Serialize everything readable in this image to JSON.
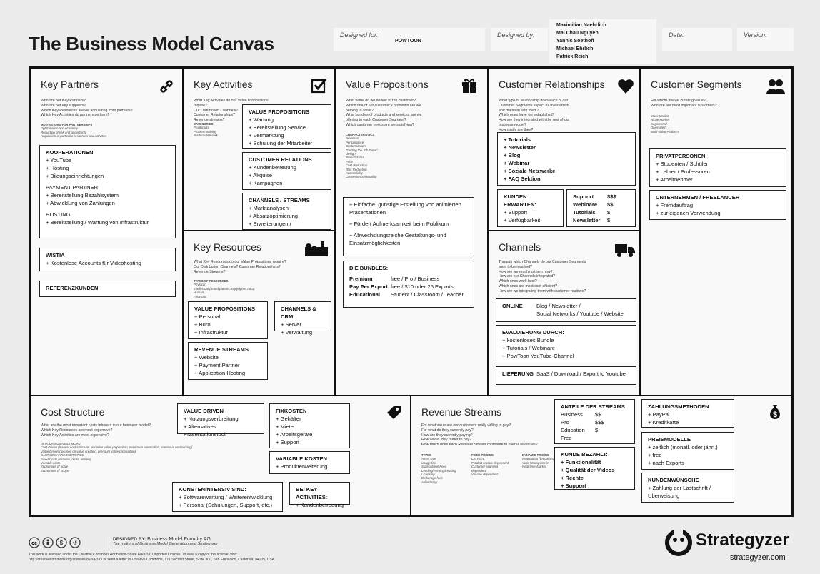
{
  "header": {
    "title": "The Business Model Canvas",
    "designed_for_label": "Designed for:",
    "designed_for_value": "POWTOON",
    "designed_by_label": "Designed by:",
    "designers": [
      "Maximilian Naehrlich",
      "Mai Chau Nguyen",
      "Yannic Soethoff",
      "Michael Ehrlich",
      "Patrick Reich"
    ],
    "date_label": "Date:",
    "version_label": "Version:"
  },
  "kp": {
    "title": "Key Partners",
    "q": [
      "Who are our Key Partners?",
      "Who are our key suppliers?",
      "Which Key Resources are we acquairing from partners?",
      "Which Key Activities do partners perform?"
    ],
    "sub": [
      "MOTIVATIONS FOR PARTNERSHIPS",
      "Optimization and economy",
      "Reduction of risk and uncertainty",
      "Acquisition of particular resources and activities"
    ],
    "n1": [
      "KOOPERATIONEN",
      "+ YouTube",
      "+ Hosting",
      "+ Bildungseinrichtungen",
      "",
      "PAYMENT PARTNER",
      "+ Bereitstellung Bezahlsystem",
      "+ Abwicklung von Zahlungen",
      "",
      "HOSTING",
      "+ Bereitstellung / Wartung von Infrastruktur"
    ],
    "n2": [
      "WISTIA",
      "+ Kostenlose Accounts für Videohosting"
    ],
    "n3": [
      "REFERENZKUNDEN"
    ]
  },
  "ka": {
    "title": "Key Activities",
    "q": [
      "What Key Activities do our Value Propositions require?",
      "Our Distribution Channels?",
      "Customer Relationships?",
      "Revenue streams?"
    ],
    "sub": [
      "CATEGORIES",
      "Production",
      "Problem Solving",
      "Platform/Network"
    ],
    "n1": [
      "VALUE PROPOSITIONS",
      "+ Wartung",
      "+ Bereitstellung Service",
      "+ Vermarktung",
      "+ Schulung der Mitarbeiter"
    ],
    "n2": [
      "CUSTOMER RELATIONS",
      "+ Kundenbetreuung",
      "+ Akquise",
      "+ Kampagnen"
    ],
    "n3": [
      "CHANNELS / STREAMS",
      "+ Marktanalysen",
      "+ Absatzoptimierung",
      "+ Erweiterungen / Anpassungen"
    ]
  },
  "kr": {
    "title": "Key Resources",
    "q": [
      "What Key Resources do our Value Propositions require?",
      "Our Distribution Channels? Customer Relationships?",
      "Revenue Streams?"
    ],
    "sub": [
      "TYPES OF RESOURCES",
      "Physical",
      "Intellectual (brand patents, copyrights, data)",
      "Human",
      "Financial"
    ],
    "n1": [
      "VALUE PROPOSITIONS",
      "+ Personal",
      "+ Büro",
      "+ Infrastruktur"
    ],
    "n2": [
      "CHANNELS & CRM",
      "+ Server",
      "+ Verwaltung"
    ],
    "n3": [
      "REVENUE STREAMS",
      "+ Website",
      "+ Payment Partner",
      "+ Application Hosting"
    ]
  },
  "vp": {
    "title": "Value Propositions",
    "q": [
      "What value do we deliver to the customer?",
      "Which one of our customer's problems are we",
      "helping to solve?",
      "What bundles of products and services are we",
      "offering to each Customer Segment?",
      "Which customer needs are we satisfying?"
    ],
    "sub": [
      "CHARACTERISTICS",
      "Newness",
      "Performance",
      "Customization",
      "\"Getting the Job Done\"",
      "Design",
      "Brand/Status",
      "Price",
      "Cost Reduction",
      "Risk Reduction",
      "Accessibility",
      "Convenience/Usability"
    ],
    "n1": [
      "+ Einfache, günstige Erstellung von animierten",
      "Präsentationen",
      "",
      "+ Fördert Aufmerksamkeit beim Publikum",
      "",
      "+ Abwechslungsreiche Gestaltungs- und",
      "Einsatzmöglichkeiten"
    ],
    "bundles_title": "DIE BUNDLES:",
    "bundles": [
      [
        "Premium",
        "free / Pro / Business"
      ],
      [
        "Pay Per Export",
        "free / $10 oder 25 Exports"
      ],
      [
        "Educational",
        "Student / Classroom / Teacher"
      ]
    ]
  },
  "cr": {
    "title": "Customer Relationships",
    "q": [
      "What type of relationship does each of our",
      "Customer Segments expect us to establish",
      "and maintain with them?",
      "Which ones have we established?",
      "How are they integrated with the rest of our",
      "business model?",
      "How costly are they?"
    ],
    "n1": [
      "+ Tutorials",
      "+ Newsletter",
      "+ Blog",
      "+ Webinar",
      "+ Soziale Netzwerke",
      "+ FAQ Sektion"
    ],
    "n2": [
      "KUNDEN ERWARTEN:",
      "+ Support",
      "+ Verfügbarkeit"
    ],
    "n3": [
      [
        "Support",
        "$$$"
      ],
      [
        "Webinare",
        "$$"
      ],
      [
        "Tutorials",
        "$"
      ],
      [
        "Newsletter",
        "$"
      ]
    ]
  },
  "ch": {
    "title": "Channels",
    "q": [
      "Through which Channels do our Customer Segments",
      "want to be reached?",
      "How are we reaching them now?",
      "How are our Channels integrated?",
      "Which ones work best?",
      "Which ones are most cost-efficient?",
      "How are we integrating them with customer routines?"
    ],
    "online_label": "ONLINE",
    "online_lines": [
      "Blog / Newsletter /",
      "Social Networks / Youtube / Website"
    ],
    "n2": [
      "EVALUIERUNG DURCH:",
      "+ kostenloses Bundle",
      "+ Tutorials / Webinare",
      "+ PowToon YouTube-Channel"
    ],
    "lief_label": "LIEFERUNG",
    "lief_value": "SaaS / Download / Export to Youtube"
  },
  "cs": {
    "title": "Customer Segments",
    "q": [
      "For whom are we creating value?",
      "Who are our most important customers?"
    ],
    "sub": [
      "Mass Market",
      "Niche Market",
      "Segmented",
      "Diversified",
      "Multi-sided Platform"
    ],
    "n1": [
      "PRIVATPERSONEN",
      "+ Studenten / Schüler",
      "+ Lehrer / Professoren",
      "+ Arbeitnehmer"
    ],
    "n2": [
      "UNTERNEHMEN / FREELANCER",
      "+ Fremdauftrag",
      "+ zur eigenen Verwendung"
    ]
  },
  "cost": {
    "title": "Cost Structure",
    "q": [
      "What are the most important costs inherent in our business model?",
      "Which Key Resources are most expensive?",
      "Which Key Activities are most expensive?"
    ],
    "sub": [
      "IS YOUR BUSINESS MORE",
      "Cost Driven (leanest cost structure, low price value proposition, maximum automation, extensive outsourcing)",
      "Value Driven (focused on value creation, premium value proposition)",
      "SAMPLE CHARACTERISTICS",
      "Fixed Costs (salaries, rents, utilities)",
      "Variable costs",
      "Economies of scale",
      "Economies of scope"
    ],
    "n1": [
      "VALUE DRIVEN",
      "+ Nutzungsverbreitung",
      "+ Alternatives Präsentationstool"
    ],
    "n2": [
      "FIXKOSTEN",
      "+ Gehälter",
      "+ Miete",
      "+ Arbeitsgeräte",
      "+ Support"
    ],
    "n3": [
      "VARIABLE KOSTEN",
      "+ Produkterweiterung"
    ],
    "n4": [
      "KONSTENINTENSIV SIND:",
      "+ Softwarewartung / Weiterentwicklung",
      "+ Personal (Schulungen, Support, etc.)"
    ],
    "n5": [
      "BEI KEY ACTIVITIES:",
      "+ Kundenbetreuung"
    ]
  },
  "rev": {
    "title": "Revenue Streams",
    "q": [
      "For what value are our customers really willing to pay?",
      "For what do they currently pay?",
      "How are they currently paying?",
      "How would they prefer to pay?",
      "How much does each Revenue Stream contribute to overall revenues?"
    ],
    "types": [
      "TYPES",
      "Asset sale",
      "Usage fee",
      "Subscription Fees",
      "Lending/Renting/Leasing",
      "Licensing",
      "Brokerage fees",
      "Advertising"
    ],
    "fixed": [
      "FIXED PRICING",
      "List Price",
      "Product feature dependent",
      "Customer segment",
      "dependent",
      "Volume dependent"
    ],
    "dyn": [
      "DYNAMIC PRICING",
      "Negotiation (bargaining)",
      "Yield Management",
      "Real-time-Market"
    ],
    "n1_title": "ANTEILE DER STREAMS",
    "n1": [
      [
        "Business",
        "$$"
      ],
      [
        "Pro",
        "$$$"
      ],
      [
        "Education",
        "$"
      ],
      [
        "Free",
        ""
      ]
    ],
    "n2": [
      "KUNDE BEZAHLT:",
      "+ Funktionalität",
      "+ Qualität der Videos",
      "+ Rechte",
      "+ Support"
    ],
    "n3": [
      "ZAHLUNGSMETHODEN",
      "+ PayPal",
      "+ Kreditkarte"
    ],
    "n4": [
      "PREISMODELLE",
      "+ zeitlich (monatl. oder jährl.)",
      "+ free",
      "+ nach Exports"
    ],
    "n5": [
      "KUNDENWÜNSCHE",
      "+ Zahlung per Lastschrift /",
      "Überweisung"
    ]
  },
  "footer": {
    "designed_by_label": "DESIGNED BY:",
    "designed_by": "Business Model Foundry AG",
    "tagline": "The makers of Business Model Generation and Strategyzer",
    "license": [
      "This work is licensed under the Creative Commons Attribution-Share Alike 3.0 Unported License. To view a copy of this license, visit:",
      "http://creativecommons.org/licenses/by-sa/3.0/ or send a letter to Creative Commons, 171 Second Street, Suite 300, San Francisco, California, 94105, USA."
    ],
    "brand": "Strategyzer",
    "url": "strategyzer.com"
  }
}
